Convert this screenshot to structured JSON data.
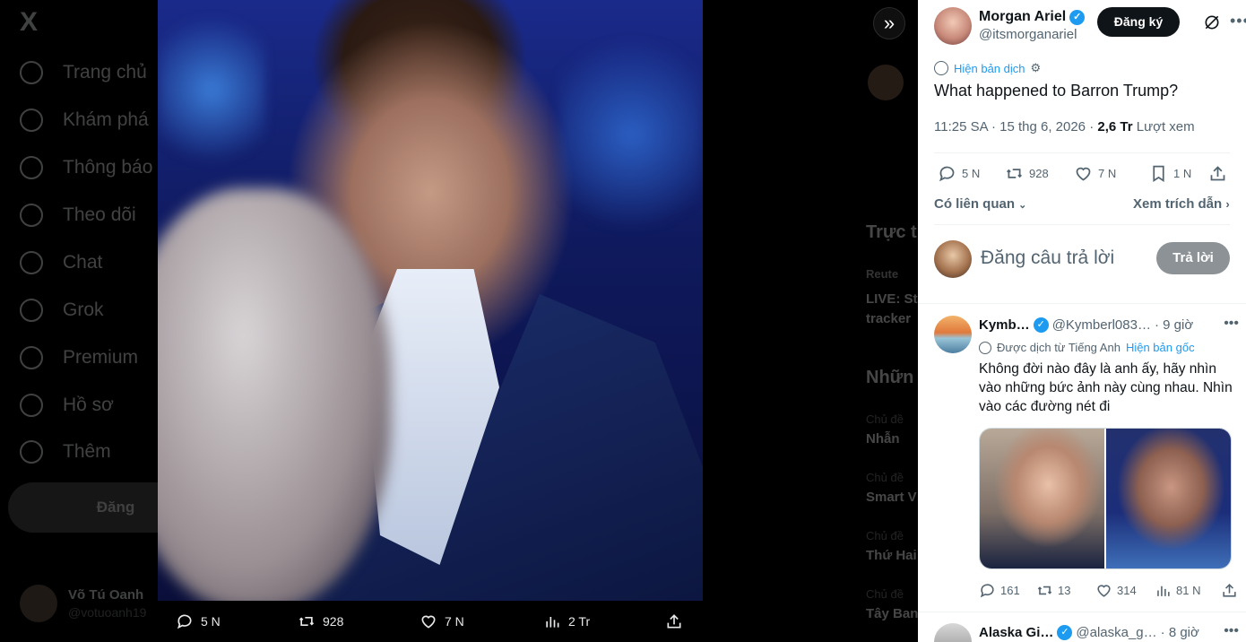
{
  "background": {
    "nav": {
      "logo": "X",
      "items": [
        {
          "label": "Trang chủ"
        },
        {
          "label": "Khám phá"
        },
        {
          "label": "Thông báo"
        },
        {
          "label": "Theo dõi"
        },
        {
          "label": "Chat"
        },
        {
          "label": "Grok"
        },
        {
          "label": "Premium"
        },
        {
          "label": "Hồ sơ"
        },
        {
          "label": "Thêm"
        }
      ],
      "post_label": "Đăng",
      "user_name": "Võ Tú Oanh",
      "user_handle": "@votuoanh19"
    },
    "right": {
      "trending_heading": "Trực t",
      "news_source": "Reute",
      "news_title_1": "LIVE: St",
      "news_title_2": "tracker",
      "section_heading": "Nhữn",
      "items": [
        {
          "meta": "Chủ đề",
          "title": "Nhẫn"
        },
        {
          "meta": "Chủ đề",
          "title": "Smart V"
        },
        {
          "meta": "Chủ đề",
          "title": "Thứ Hai"
        },
        {
          "meta": "Chủ đề",
          "title": "Tây Ban"
        }
      ]
    }
  },
  "media_bar": {
    "replies": "5 N",
    "reposts": "928",
    "likes": "7 N",
    "views": "2 Tr"
  },
  "panel": {
    "author": {
      "name": "Morgan Ariel",
      "handle": "@itsmorganariel",
      "subscribe_label": "Đăng ký"
    },
    "show_translation": "Hiện bản dịch",
    "tweet_text": "What happened to Barron Trump?",
    "meta": {
      "time_date": "11:25 SA · 15 thg 6, 2026 · ",
      "views": "2,6 Tr",
      "views_label": " Lượt xem"
    },
    "stats": {
      "replies": "5 N",
      "reposts": "928",
      "likes": "7 N",
      "bookmarks": "1 N"
    },
    "related_label": "Có liên quan",
    "quotes_label": "Xem trích dẫn",
    "reply_placeholder": "Đăng câu trả lời",
    "reply_button": "Trả lời",
    "reply": {
      "name": "Kymb…",
      "handle": "@Kymberl083…",
      "time": "· 9 giờ",
      "translated_from": "Được dịch từ Tiếng Anh",
      "show_original": "Hiện bản gốc",
      "text": "Không đời nào đây là anh ấy, hãy nhìn vào những bức ảnh này cùng nhau. Nhìn vào các đường nét đi",
      "replies": "161",
      "reposts": "13",
      "likes": "314",
      "views": "81 N"
    },
    "reply2": {
      "name": "Alaska Gi…",
      "handle": "@alaska_g…",
      "time": "· 8 giờ"
    }
  }
}
